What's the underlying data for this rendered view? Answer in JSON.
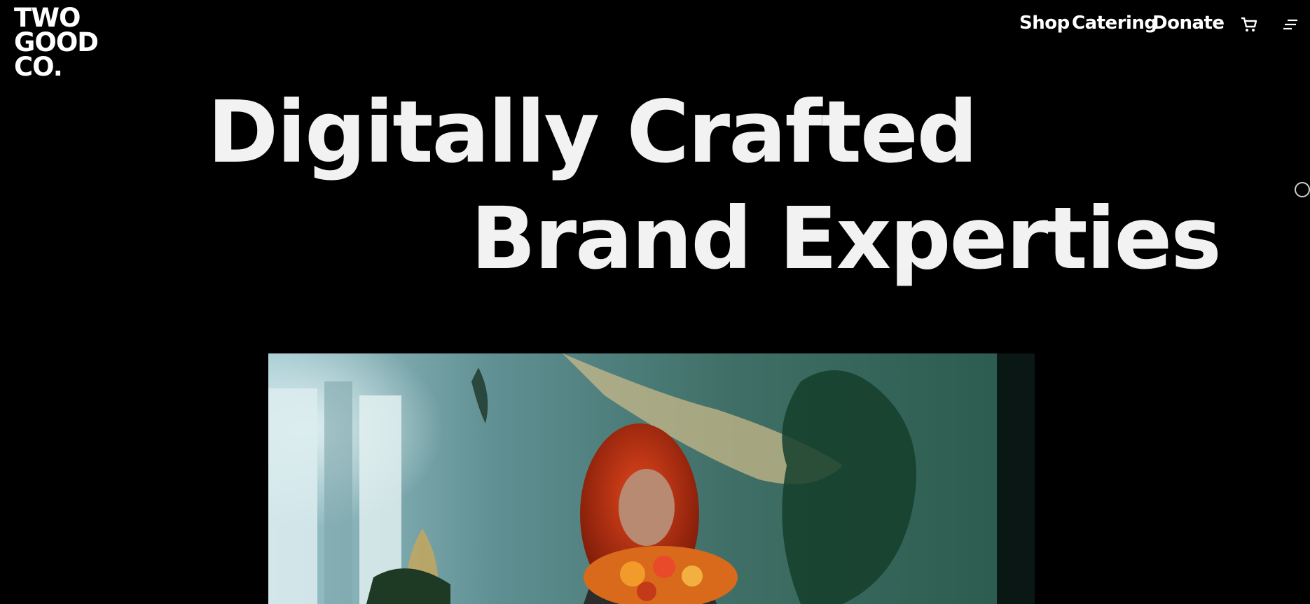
{
  "logo": {
    "line1": "TWO",
    "line2": "GOOD",
    "line3": "CO."
  },
  "nav": {
    "shop": "Shop",
    "catering": "Catering",
    "donate": "Donate",
    "cart_icon": "cart-icon",
    "menu_icon": "menu-icon"
  },
  "hero": {
    "line1": "Digitally Crafted",
    "line2": "Brand Experties"
  },
  "video": {
    "icon": "video-still"
  },
  "colors": {
    "background": "#000000",
    "text": "#f2f2f2"
  }
}
